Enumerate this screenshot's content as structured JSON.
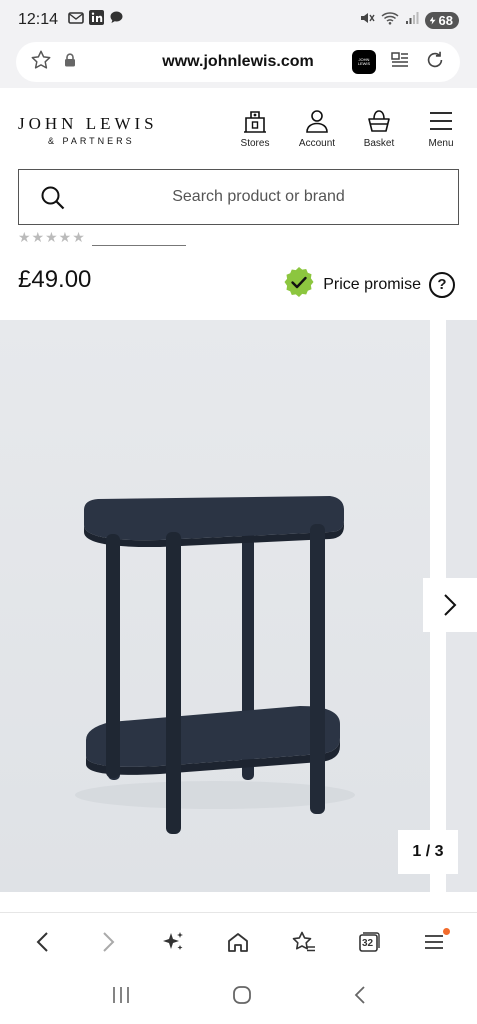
{
  "status_bar": {
    "time": "12:14",
    "battery": "68",
    "left_icons": [
      "mail-icon",
      "linkedin-icon",
      "chat-icon"
    ],
    "right_icons": [
      "mute-icon",
      "wifi-icon",
      "signal-icon"
    ]
  },
  "browser": {
    "url": "www.johnlewis.com",
    "icons": [
      "favorite-star-icon",
      "lock-icon",
      "site-badge-icon",
      "reader-icon",
      "reload-icon"
    ],
    "site_badge_text": "JOHN LEWIS"
  },
  "header": {
    "logo_main": "JOHN LEWIS",
    "logo_sub": "& PARTNERS",
    "nav": [
      {
        "label": "Stores",
        "icon": "store-icon"
      },
      {
        "label": "Account",
        "icon": "account-icon"
      },
      {
        "label": "Basket",
        "icon": "basket-icon"
      },
      {
        "label": "Menu",
        "icon": "menu-icon"
      }
    ]
  },
  "search": {
    "placeholder": "Search product or brand",
    "value": ""
  },
  "product": {
    "price": "£49.00",
    "price_promise_label": "Price promise",
    "help_glyph": "?",
    "rating_stars": "★★★★★"
  },
  "gallery": {
    "counter": "1 / 3",
    "current": 1,
    "total": 3,
    "product_color": "#2b3444",
    "background": "#e4e6ea"
  },
  "bottom_toolbar": {
    "tab_count": "32",
    "icons": [
      "back-icon",
      "forward-icon",
      "sparkle-icon",
      "home-icon",
      "bookmarks-icon",
      "tabs-icon",
      "browser-menu-icon"
    ]
  },
  "system_nav": {
    "icons": [
      "recents-icon",
      "home-circle-icon",
      "system-back-icon"
    ]
  },
  "colors": {
    "accent_green": "#8cc63f",
    "notify_orange": "#f26b2b"
  }
}
